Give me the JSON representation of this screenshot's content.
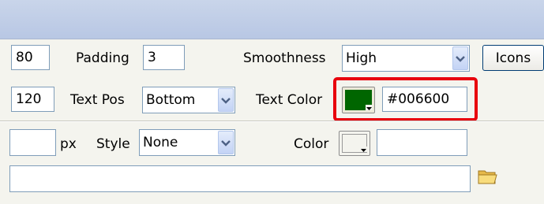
{
  "row1": {
    "first_value": "80",
    "padding_label": "Padding",
    "padding_value": "3",
    "smoothness_label": "Smoothness",
    "smoothness_selected": "High",
    "icons_button_label": "Icons"
  },
  "row2": {
    "first_value": "120",
    "text_pos_label": "Text Pos",
    "text_pos_selected": "Bottom",
    "text_color_label": "Text Color",
    "text_color_value": "#006600",
    "text_color_swatch": "#006600"
  },
  "row3": {
    "size_value": "",
    "unit_label": "px",
    "style_label": "Style",
    "style_selected": "None",
    "color_label": "Color",
    "color_value": ""
  },
  "row4": {
    "path_value": ""
  },
  "icons": {
    "dropdown": "chevron-down-icon",
    "folder": "folder-icon"
  },
  "colors": {
    "highlight": "#e8000d",
    "input_border": "#7f9db9"
  }
}
